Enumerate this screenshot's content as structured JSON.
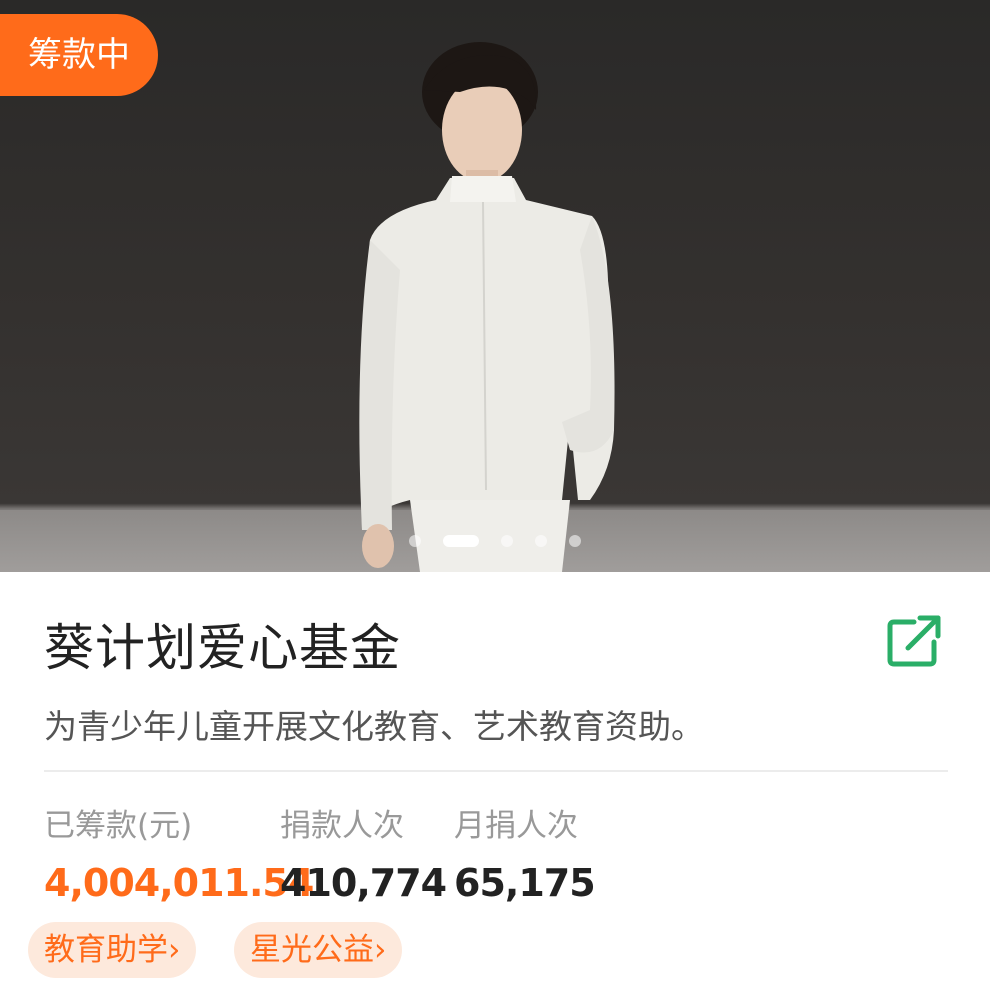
{
  "hero": {
    "status_badge": "筹款中",
    "carousel": {
      "count": 5,
      "active_index": 1
    }
  },
  "fund": {
    "title": "葵计划爱心基金",
    "description": "为青少年儿童开展文化教育、艺术教育资助。"
  },
  "stats": [
    {
      "label": "已筹款(元)",
      "value": "4,004,011.54"
    },
    {
      "label": "捐款人次",
      "value": "410,774"
    },
    {
      "label": "月捐人次",
      "value": "65,175"
    }
  ],
  "tags": [
    {
      "label": "教育助学"
    },
    {
      "label": "星光公益"
    }
  ],
  "icons": {
    "share": "share-external-icon",
    "tag_arrow": "chevron-right-icon"
  },
  "colors": {
    "accent": "#ff6b1a",
    "share_icon": "#2aae67",
    "tag_bg": "#fde9dc"
  }
}
